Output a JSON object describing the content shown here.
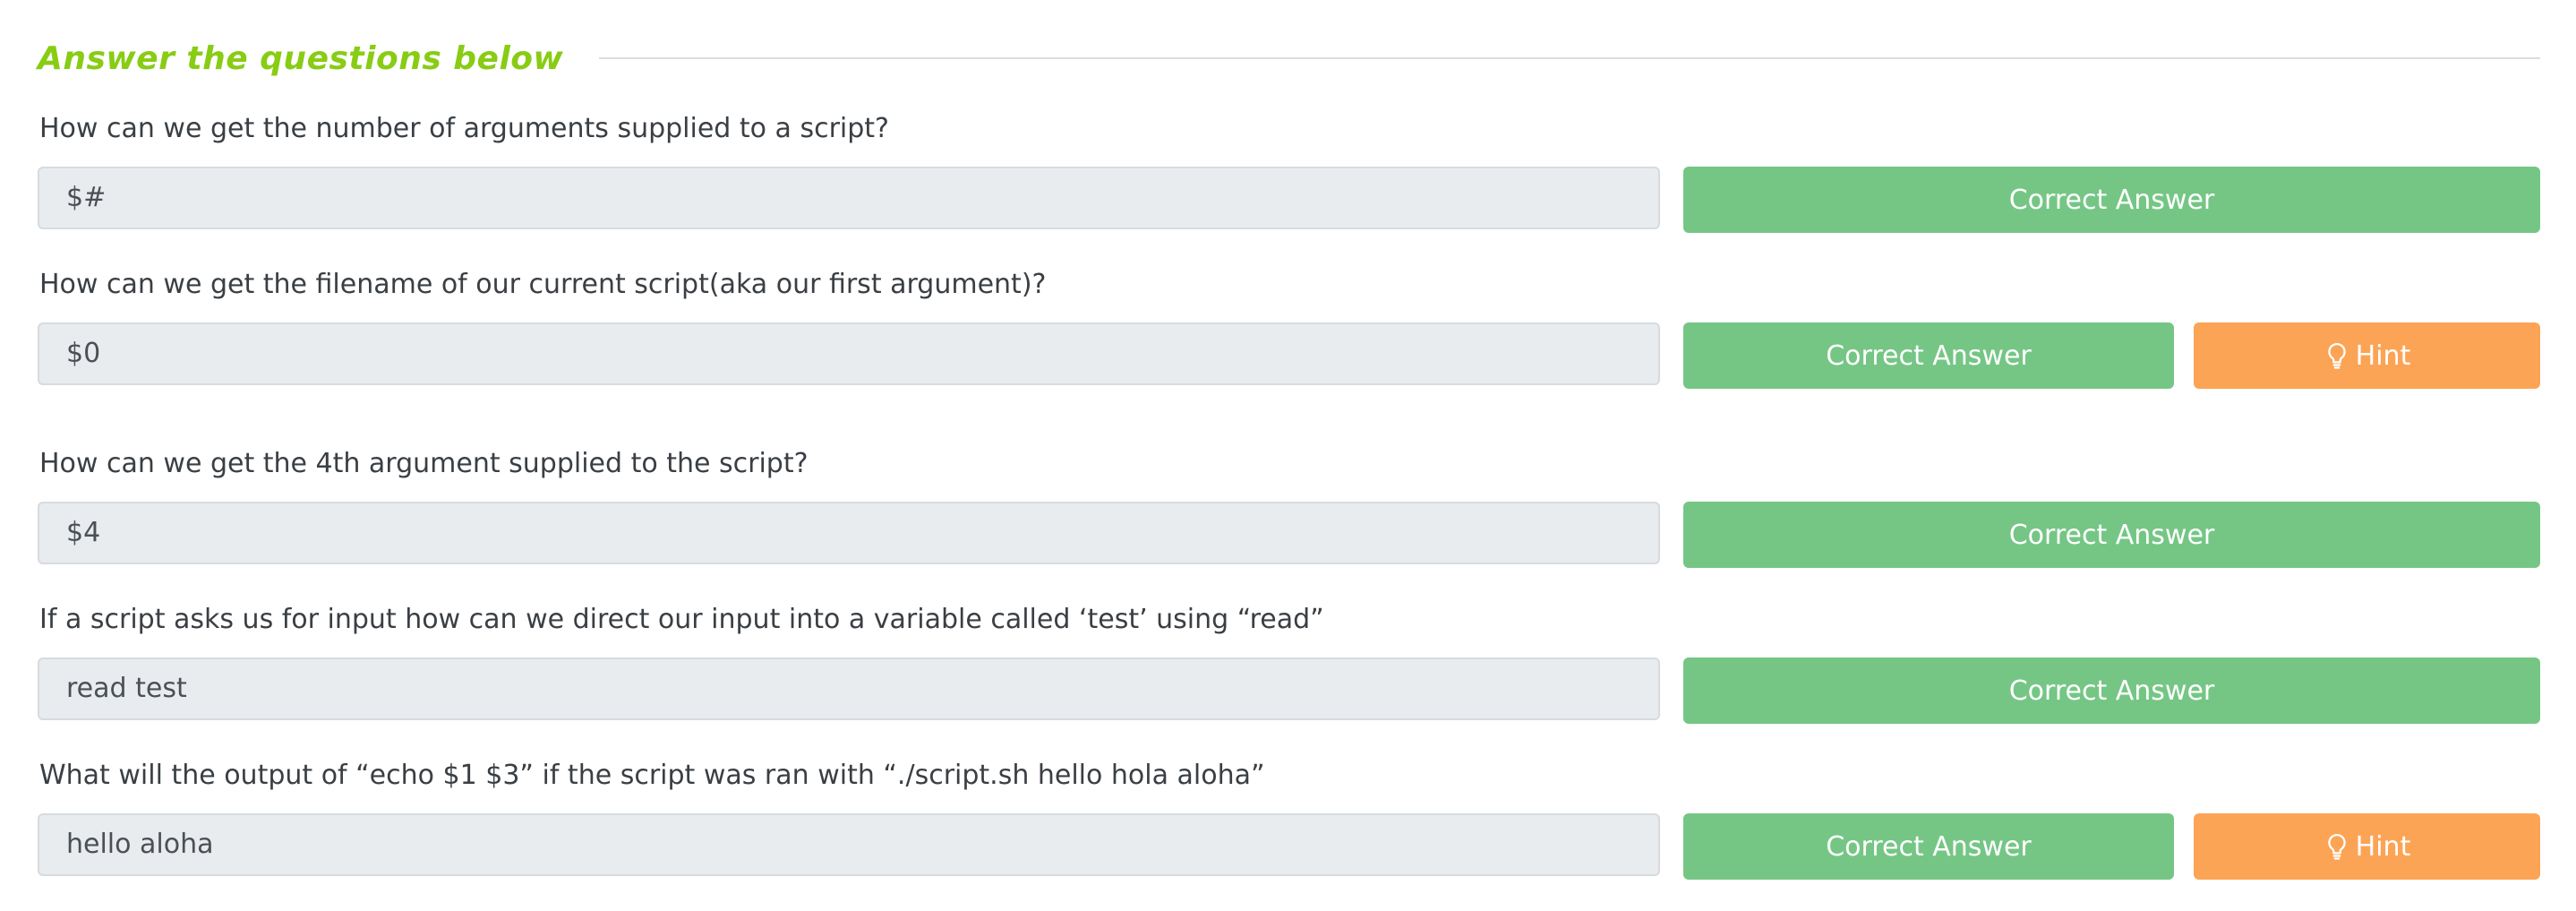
{
  "section": {
    "title": "Answer the questions below"
  },
  "colors": {
    "title": "#88cc14",
    "correct": "#75c685",
    "hint": "#fca455",
    "field_bg": "#e9ecef",
    "text": "#3a3f44"
  },
  "questions": [
    {
      "question": "How can we get the number of arguments supplied to a script?",
      "answer": "$#",
      "correct_label": "Correct Answer"
    },
    {
      "question": "How can we get the filename of our current script(aka our first argument)?",
      "answer": "$0",
      "correct_label": "Correct Answer",
      "hint_label": "Hint",
      "hint_icon": "lightbulb-icon"
    },
    {
      "question": "How can we get the 4th argument supplied to the script?",
      "answer": "$4",
      "correct_label": "Correct Answer"
    },
    {
      "question": "If a script asks us for input how can we direct our input into a variable called ‘test’ using “read”",
      "answer": "read test",
      "correct_label": "Correct Answer"
    },
    {
      "question": "What will the output of “echo $1 $3” if the script was ran with “./script.sh hello hola aloha”",
      "answer": "hello aloha",
      "correct_label": "Correct Answer",
      "hint_label": "Hint",
      "hint_icon": "lightbulb-icon"
    }
  ]
}
